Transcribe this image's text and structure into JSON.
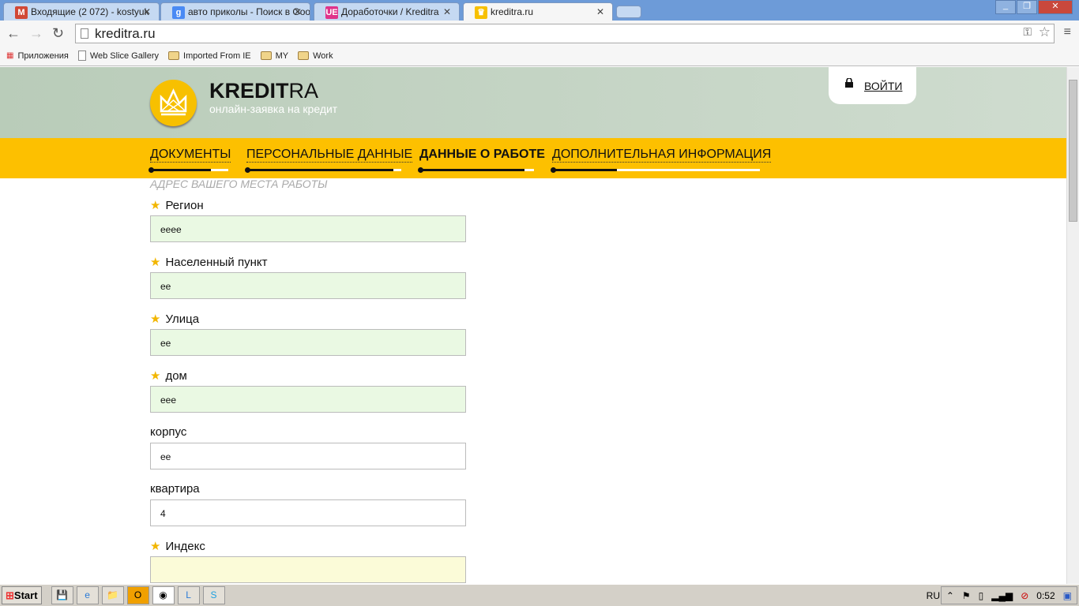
{
  "browser": {
    "tabs": [
      {
        "title": "Входящие (2 072) - kostyuk",
        "icon": "gmail-icon",
        "color": "#d14836",
        "glyph": "M"
      },
      {
        "title": "авто приколы - Поиск в Goo",
        "icon": "google-icon",
        "color": "#4a8af4",
        "glyph": "g"
      },
      {
        "title": "Доработочки / Kreditra",
        "icon": "ue-icon",
        "color": "#e0338a",
        "glyph": "UE"
      },
      {
        "title": "kreditra.ru",
        "icon": "kreditra-icon",
        "color": "#f7c000",
        "glyph": "♛"
      }
    ],
    "active_tab": 3,
    "url": "kreditra.ru",
    "bookmarks": [
      "Приложения",
      "Web Slice Gallery",
      "Imported From IE",
      "MY",
      "Work"
    ]
  },
  "site": {
    "brand_bold": "KREDIT",
    "brand_light": "RA",
    "tagline": "онлайн-заявка на кредит",
    "login": "ВОЙТИ",
    "steps": [
      {
        "label": "ДОКУМЕНТЫ",
        "progress": 0.78,
        "current": false
      },
      {
        "label": "ПЕРСОНАЛЬНЫЕ ДАННЫЕ",
        "progress": 0.95,
        "current": false
      },
      {
        "label": "ДАННЫЕ О РАБОТЕ",
        "progress": 0.92,
        "current": true
      },
      {
        "label": "ДОПОЛНИТЕЛЬНАЯ ИНФОРМАЦИЯ",
        "progress": 0.31,
        "current": false
      }
    ],
    "section_title": "АДРЕС ВАШЕГО МЕСТА РАБОТЫ",
    "fields": [
      {
        "label": "Регион",
        "value": "eeee",
        "required": true
      },
      {
        "label": "Населенный пункт",
        "value": "ee",
        "required": true
      },
      {
        "label": "Улица",
        "value": "ee",
        "required": true
      },
      {
        "label": "дом",
        "value": "eee",
        "required": true
      },
      {
        "label": "корпус",
        "value": "ee",
        "required": false
      },
      {
        "label": "квартира",
        "value": "4",
        "required": false
      },
      {
        "label": "Индекс",
        "value": "",
        "required": true
      }
    ]
  },
  "taskbar": {
    "start": "Start",
    "lang": "RU",
    "time": "0:52"
  }
}
